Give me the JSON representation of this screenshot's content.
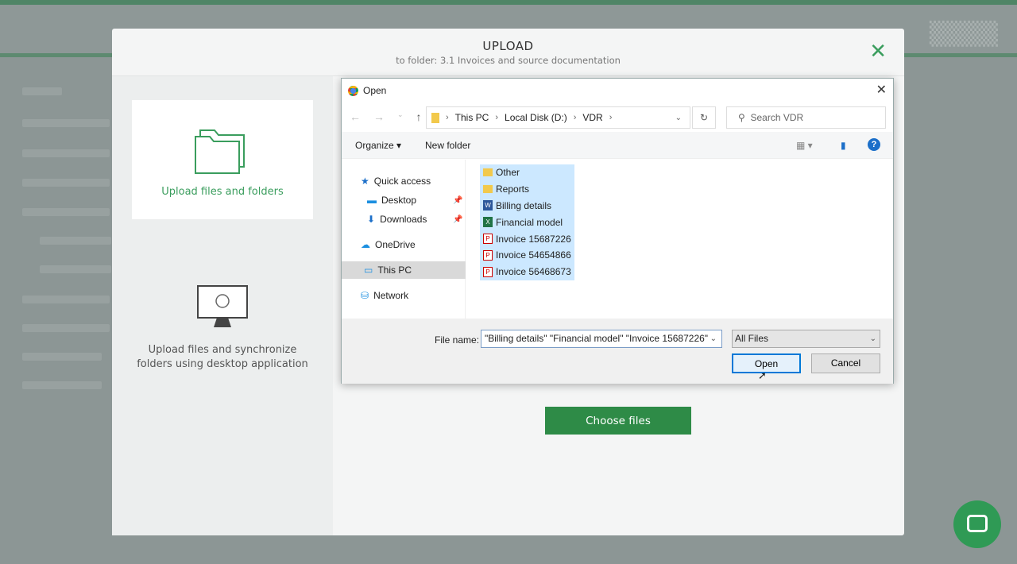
{
  "modal": {
    "title": "UPLOAD",
    "subtitle": "to folder: 3.1 Invoices and source documentation",
    "upload_card_label": "Upload files and folders",
    "desktop_label_1": "Upload files and synchronize",
    "desktop_label_2": "folders using desktop application",
    "choose_files": "Choose files"
  },
  "dialog": {
    "title": "Open",
    "path": [
      "This PC",
      "Local Disk (D:)",
      "VDR"
    ],
    "search_placeholder": "Search VDR",
    "organize": "Organize ▾",
    "new_folder": "New folder",
    "tree": [
      {
        "label": "Quick access"
      },
      {
        "label": "Desktop"
      },
      {
        "label": "Downloads"
      },
      {
        "label": "OneDrive"
      },
      {
        "label": "This PC"
      },
      {
        "label": "Network"
      }
    ],
    "files": [
      {
        "name": "Other",
        "type": "folder"
      },
      {
        "name": "Reports",
        "type": "folder"
      },
      {
        "name": "Billing details",
        "type": "word"
      },
      {
        "name": "Financial model",
        "type": "excel"
      },
      {
        "name": "Invoice 15687226",
        "type": "pdf"
      },
      {
        "name": "Invoice 54654866",
        "type": "pdf"
      },
      {
        "name": "Invoice 56468673",
        "type": "pdf"
      }
    ],
    "file_name_label": "File name:",
    "file_name_value": "\"Billing details\" \"Financial model\" \"Invoice 15687226\"",
    "file_type": "All Files",
    "open": "Open",
    "cancel": "Cancel"
  },
  "colors": {
    "accent": "#2e8b47",
    "selection": "#cce8ff"
  }
}
